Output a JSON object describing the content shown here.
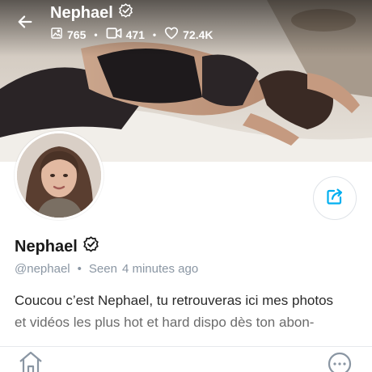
{
  "header": {
    "title": "Nephael",
    "stats": {
      "photos": "765",
      "videos": "471",
      "likes": "72.4K"
    }
  },
  "profile": {
    "name": "Nephael",
    "handle": "@nephael",
    "seen_label": "Seen",
    "seen_time": "4 minutes ago",
    "bio_line1": "Coucou c’est Nephael, tu retrouveras ici mes photos",
    "bio_line2": "et vidéos les plus hot et hard dispo dès ton abon-"
  },
  "icons": {
    "back": "arrow-left-icon",
    "verified": "verified-badge-icon",
    "photos": "image-icon",
    "videos": "video-icon",
    "likes": "heart-icon",
    "share": "share-icon",
    "home": "home-icon",
    "more": "more-icon"
  },
  "colors": {
    "accent": "#00aff0",
    "muted": "#8a96a3"
  }
}
